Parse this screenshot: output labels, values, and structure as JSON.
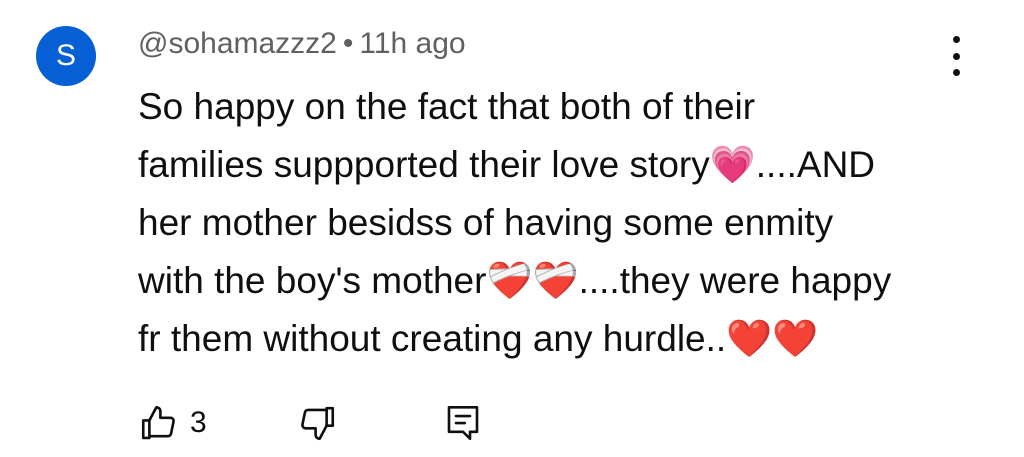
{
  "comment": {
    "avatar_letter": "S",
    "avatar_color": "#065fd4",
    "author": "@sohamazzz2",
    "separator": "•",
    "timestamp": "11h ago",
    "text": "So happy on the fact that both of their\nfamilies suppported their love story💗....AND\nher mother besidss of having some enmity\nwith the boy's mother❤️‍🩹❤️‍🩹....they were happy\nfr them without creating any hurdle..❤️❤️",
    "like_count": "3"
  },
  "icons": {
    "more": "more-vertical-icon",
    "like": "thumbs-up-icon",
    "dislike": "thumbs-down-icon",
    "reply": "reply-comment-icon"
  }
}
